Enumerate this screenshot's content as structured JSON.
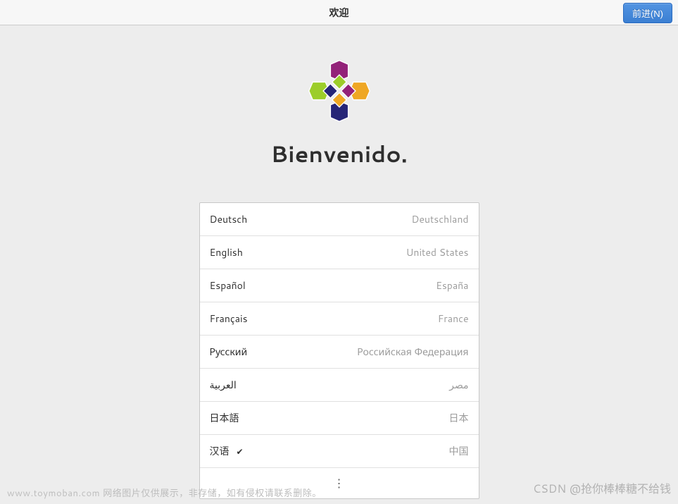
{
  "header": {
    "title": "欢迎",
    "next_label": "前进(N)"
  },
  "welcome_text": "Bienvenido.",
  "languages": [
    {
      "name": "Deutsch",
      "country": "Deutschland",
      "selected": false
    },
    {
      "name": "English",
      "country": "United States",
      "selected": false
    },
    {
      "name": "Español",
      "country": "España",
      "selected": false
    },
    {
      "name": "Français",
      "country": "France",
      "selected": false
    },
    {
      "name": "Русский",
      "country": "Российская Федерация",
      "selected": false
    },
    {
      "name": "العربية",
      "country": "مصر",
      "selected": false
    },
    {
      "name": "日本語",
      "country": "日本",
      "selected": false
    },
    {
      "name": "汉语",
      "country": "中国",
      "selected": true
    }
  ],
  "icons": {
    "check": "✔",
    "more": "⋮"
  },
  "watermarks": {
    "left": "www.toymoban.com 网络图片仅供展示，非存储，如有侵权请联系删除。",
    "right": "CSDN @抢你棒棒糖不给钱"
  }
}
